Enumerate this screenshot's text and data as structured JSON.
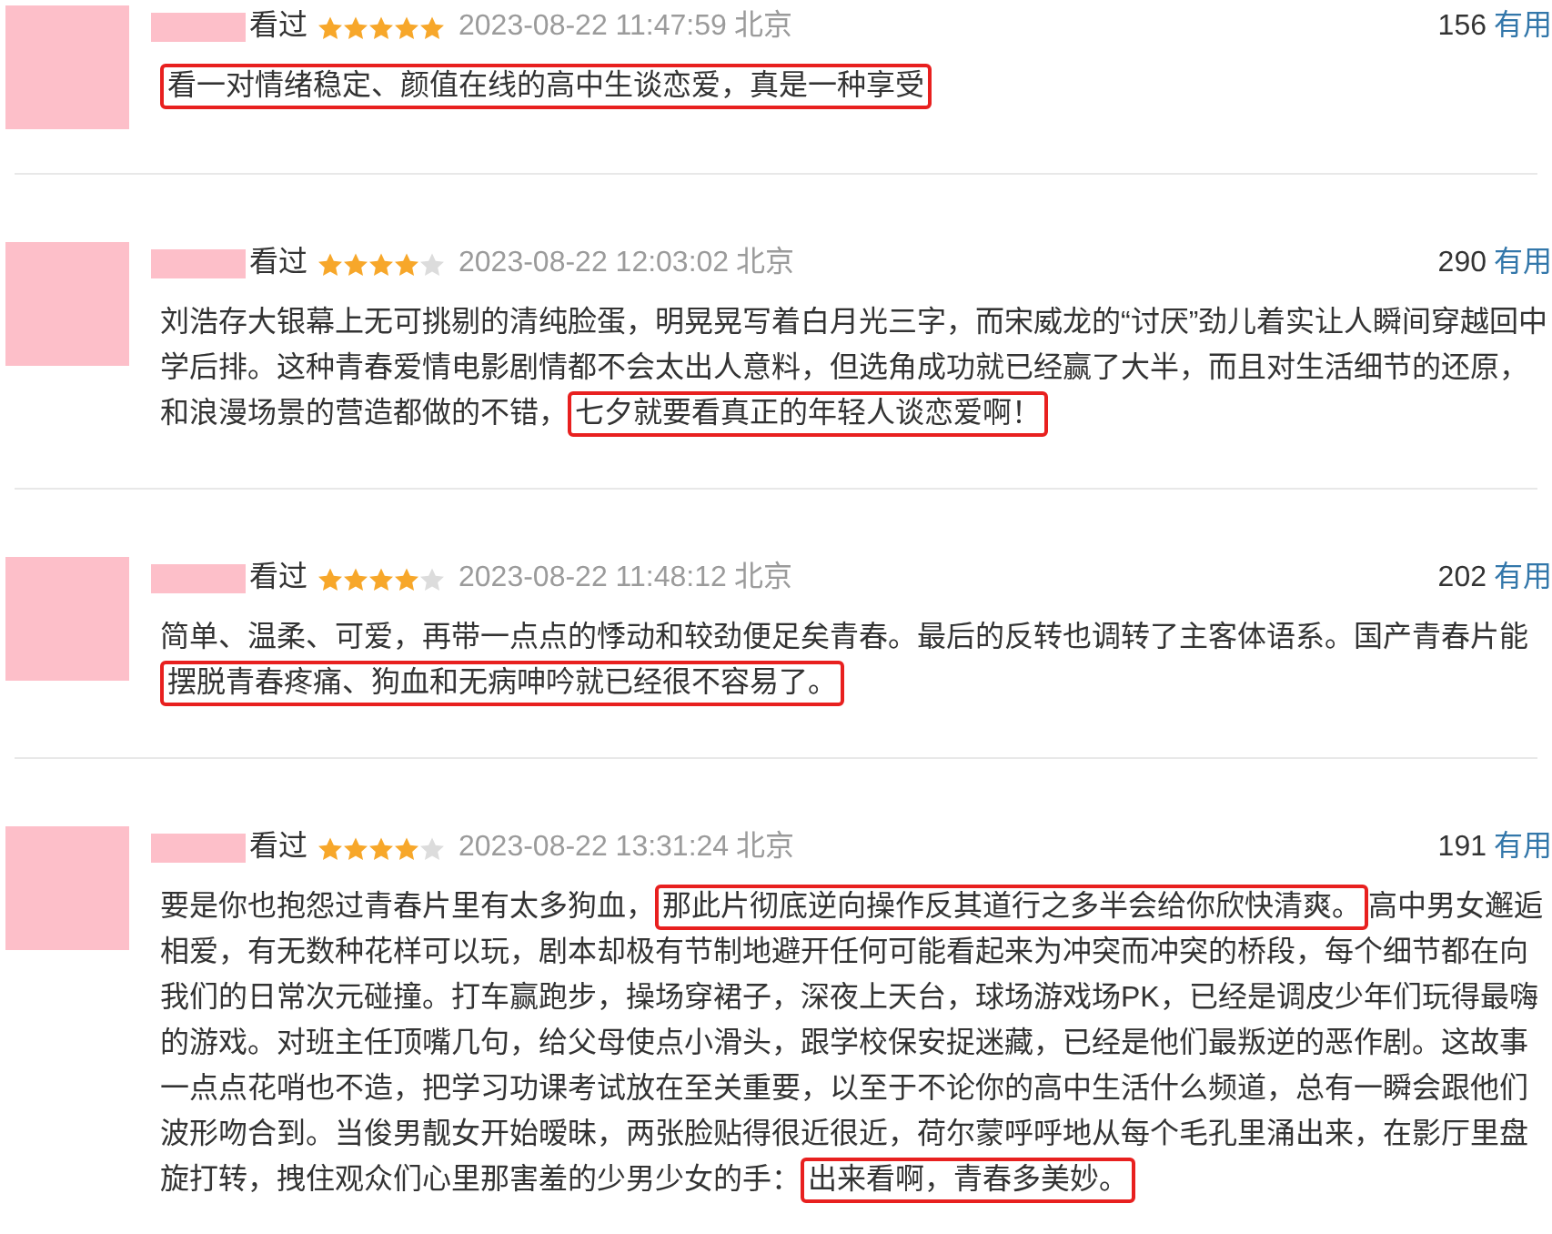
{
  "reviews": [
    {
      "status": "看过",
      "stars": 5,
      "time": "2023-08-22 11:47:59",
      "location": "北京",
      "votes": "156",
      "vote_label": "有用",
      "content": [
        {
          "text": "看一对情绪稳定、颜值在线的高中生谈恋爱，真是一种享受",
          "highlighted": true
        }
      ]
    },
    {
      "status": "看过",
      "stars": 4,
      "time": "2023-08-22 12:03:02",
      "location": "北京",
      "votes": "290",
      "vote_label": "有用",
      "content": [
        {
          "text": "刘浩存大银幕上无可挑剔的清纯脸蛋，明晃晃写着白月光三字，而宋威龙的“讨厌”劲儿着实让人瞬间穿越回中学后排。这种青春爱情电影剧情都不会太出人意料，但选角成功就已经赢了大半，而且对生活细节的还原，和浪漫场景的营造都做的不错，",
          "highlighted": false
        },
        {
          "text": "七夕就要看真正的年轻人谈恋爱啊！",
          "highlighted": true
        }
      ]
    },
    {
      "status": "看过",
      "stars": 4,
      "time": "2023-08-22 11:48:12",
      "location": "北京",
      "votes": "202",
      "vote_label": "有用",
      "content": [
        {
          "text": "简单、温柔、可爱，再带一点点的悸动和较劲便足矣青春。最后的反转也调转了主客体语系。国产青春片能",
          "highlighted": false
        },
        {
          "text": "摆脱青春疼痛、狗血和无病呻吟就已经很不容易了。",
          "highlighted": true
        }
      ]
    },
    {
      "status": "看过",
      "stars": 4,
      "time": "2023-08-22 13:31:24",
      "location": "北京",
      "votes": "191",
      "vote_label": "有用",
      "content": [
        {
          "text": "要是你也抱怨过青春片里有太多狗血，",
          "highlighted": false
        },
        {
          "text": "那此片彻底逆向操作反其道行之多半会给你欣快清爽。",
          "highlighted": true
        },
        {
          "text": "高中男女邂逅相爱，有无数种花样可以玩，剧本却极有节制地避开任何可能看起来为冲突而冲突的桥段，每个细节都在向我们的日常次元碰撞。打车赢跑步，操场穿裙子，深夜上天台，球场游戏场PK，已经是调皮少年们玩得最嗨的游戏。对班主任顶嘴几句，给父母使点小滑头，跟学校保安捉迷藏，已经是他们最叛逆的恶作剧。这故事一点点花哨也不造，把学习功课考试放在至关重要，以至于不论你的高中生活什么频道，总有一瞬会跟他们波形吻合到。当俊男靓女开始暧昧，两张脸贴得很近很近，荷尔蒙呼呼地从每个毛孔里涌出来，在影厅里盘旋打转，拽住观众们心里那害羞的少男少女的手：",
          "highlighted": false
        },
        {
          "text": "出来看啊，青春多美妙。",
          "highlighted": true
        }
      ]
    }
  ]
}
